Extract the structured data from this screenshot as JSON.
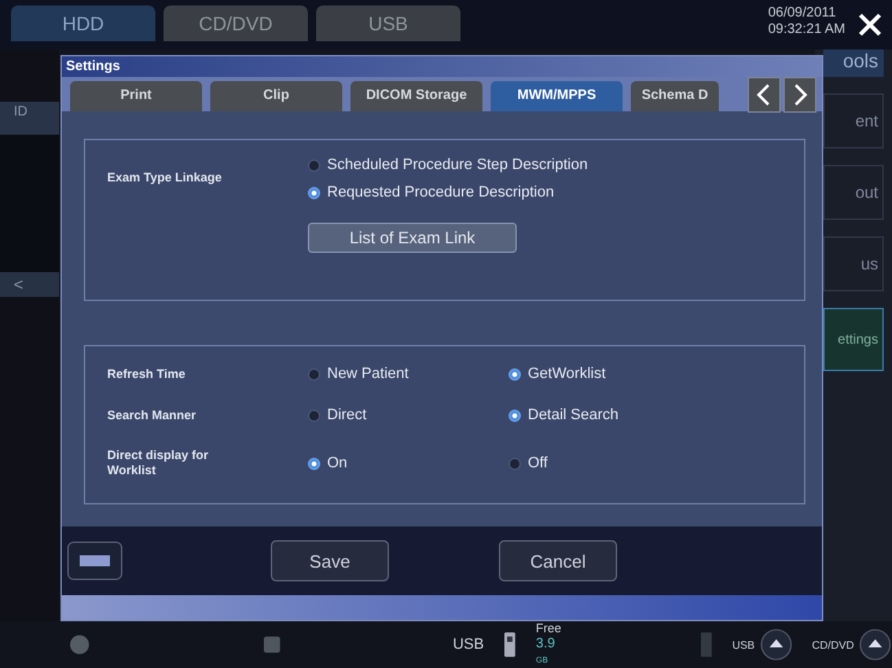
{
  "top_tabs": [
    {
      "label": "HDD",
      "selected": true
    },
    {
      "label": "CD/DVD",
      "selected": false
    },
    {
      "label": "USB",
      "selected": false
    }
  ],
  "datetime": {
    "date": "06/09/2011",
    "time": "09:32:21 AM"
  },
  "side_tab": {
    "label": "ools"
  },
  "left_panel": {
    "id_label": "ID",
    "back": "<"
  },
  "right_buttons": [
    {
      "label": "ent",
      "highlighted": false
    },
    {
      "label": "out",
      "highlighted": false
    },
    {
      "label": "us",
      "highlighted": false
    },
    {
      "label": "ettings",
      "highlighted": true
    }
  ],
  "dialog": {
    "title": "Settings",
    "tabs": [
      {
        "label": "Print",
        "selected": false
      },
      {
        "label": "Clip",
        "selected": false
      },
      {
        "label": "DICOM Storage",
        "selected": false
      },
      {
        "label": "MWM/MPPS",
        "selected": true
      },
      {
        "label": "Schema D",
        "selected": false
      }
    ],
    "exam_type_linkage": {
      "label": "Exam Type Linkage",
      "options": [
        {
          "label": "Scheduled Procedure Step Description",
          "selected": false
        },
        {
          "label": "Requested Procedure Description",
          "selected": true
        }
      ],
      "button": "List of Exam Link"
    },
    "settings_rows": [
      {
        "label": "Refresh Time",
        "options": [
          {
            "label": "New Patient",
            "selected": false
          },
          {
            "label": "GetWorklist",
            "selected": true
          }
        ]
      },
      {
        "label": "Search Manner",
        "options": [
          {
            "label": "Direct",
            "selected": false
          },
          {
            "label": "Detail Search",
            "selected": true
          }
        ]
      },
      {
        "label": "Direct display for Worklist",
        "options": [
          {
            "label": "On",
            "selected": true
          },
          {
            "label": "Off",
            "selected": false
          }
        ]
      }
    ],
    "buttons": [
      "Save",
      "Cancel"
    ]
  },
  "status_bar": {
    "usb_label": "USB",
    "free_label": "Free",
    "free_value": "3.9",
    "free_unit": "GB",
    "eject": [
      "USB",
      "CD/DVD"
    ]
  }
}
